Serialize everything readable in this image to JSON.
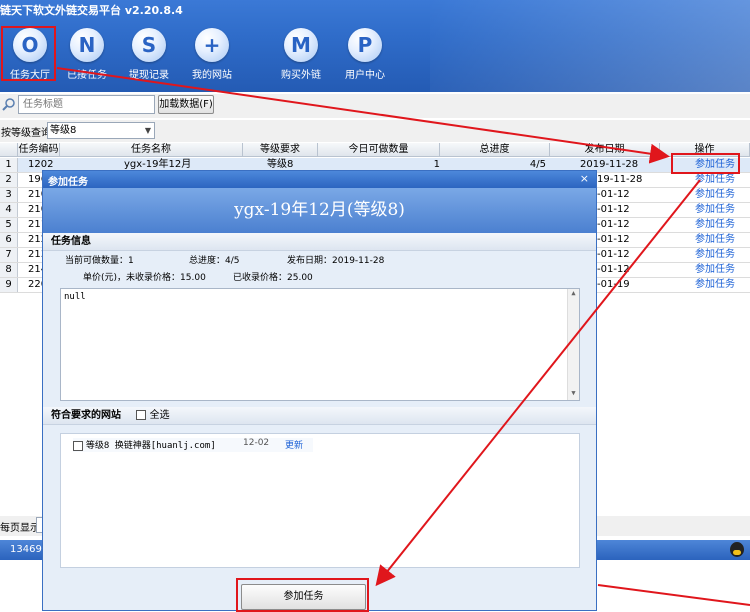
{
  "app": {
    "title": "链天下软文外链交易平台 v2.20.8.4"
  },
  "toolbar": [
    {
      "glyph": "O",
      "label": "任务大厅",
      "icon": "task-hall-icon"
    },
    {
      "glyph": "N",
      "label": "已接任务",
      "icon": "accepted-tasks-icon"
    },
    {
      "glyph": "S",
      "label": "提现记录",
      "icon": "withdraw-record-icon"
    },
    {
      "glyph": "+",
      "label": "我的网站",
      "icon": "my-sites-icon"
    },
    {
      "glyph": "M",
      "label": "购买外链",
      "icon": "buy-links-icon"
    },
    {
      "glyph": "P",
      "label": "用户中心",
      "icon": "user-center-icon"
    }
  ],
  "search": {
    "placeholder": "任务标题",
    "load_button": "加载数据(F)"
  },
  "filter": {
    "label": "按等级查询",
    "selected": "等级8"
  },
  "grid": {
    "headers": [
      "任务编码",
      "任务名称",
      "等级要求",
      "今日可做数量",
      "总进度",
      "发布日期",
      "操作"
    ],
    "rows": [
      {
        "no": "1",
        "code": "1202",
        "name": "ygx-19年12月",
        "level": "等级8",
        "today": "1",
        "progress": "4/5",
        "date": "2019-11-28",
        "action": "参加任务"
      },
      {
        "no": "2",
        "code": "196",
        "date": "19-11-28",
        "action": "参加任务"
      },
      {
        "no": "3",
        "code": "210",
        "date": "-01-12",
        "action": "参加任务"
      },
      {
        "no": "4",
        "code": "210",
        "date": "-01-12",
        "action": "参加任务"
      },
      {
        "no": "5",
        "code": "211",
        "date": "-01-12",
        "action": "参加任务"
      },
      {
        "no": "6",
        "code": "212",
        "date": "-01-12",
        "action": "参加任务"
      },
      {
        "no": "7",
        "code": "213",
        "date": "-01-12",
        "action": "参加任务"
      },
      {
        "no": "8",
        "code": "214",
        "date": "-01-12",
        "action": "参加任务"
      },
      {
        "no": "9",
        "code": "220",
        "date": "-01-19",
        "action": "参加任务"
      }
    ]
  },
  "footer": {
    "per_page": "每页显示",
    "status": "1346926"
  },
  "dialog": {
    "title": "参加任务",
    "close": "×",
    "heading": "ygx-19年12月(等级8)",
    "info_section": "任务信息",
    "today_label": "当前可做数量：",
    "today_value": "1",
    "progress_label": "总进度：",
    "progress_value": "4/5",
    "date_label": "发布日期：",
    "date_value": "2019-11-28",
    "price_label": "单价(元)，未收录价格：",
    "price_value": "15.00",
    "indexed_label": "已收录价格：",
    "indexed_value": "25.00",
    "content": "null",
    "sites_section": "符合要求的网站",
    "select_all": "全选",
    "site": {
      "name": "等级8 换链神器[huanlj.com]",
      "date": "12-02",
      "action": "更新"
    },
    "submit": "参加任务"
  },
  "colors": {
    "accent": "#2f6cc9",
    "highlight": "#e0161c",
    "link": "#1c61d6"
  }
}
